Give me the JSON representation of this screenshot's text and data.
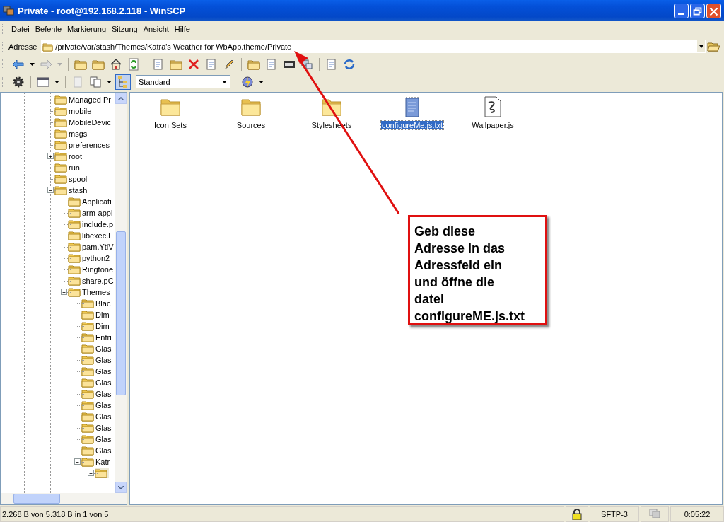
{
  "window": {
    "title": "Private - root@192.168.2.118 - WinSCP"
  },
  "menu": [
    "Datei",
    "Befehle",
    "Markierung",
    "Sitzung",
    "Ansicht",
    "Hilfe"
  ],
  "address": {
    "label": "Adresse",
    "value": "/private/var/stash/Themes/Katra's Weather for WbApp.theme/Private"
  },
  "toolbar": {
    "preset": "Standard"
  },
  "tree": [
    {
      "name": "Managed Pr",
      "selected": false
    },
    {
      "name": "mobile",
      "selected": false
    },
    {
      "name": "MobileDevic",
      "selected": false
    },
    {
      "name": "msgs",
      "selected": false
    },
    {
      "name": "preferences",
      "selected": false
    },
    {
      "name": "root",
      "selected": false,
      "expanded": false
    },
    {
      "name": "run",
      "selected": false
    },
    {
      "name": "spool",
      "selected": false
    },
    {
      "name": "stash",
      "selected": false,
      "expanded": true,
      "children": [
        {
          "name": "Applicati",
          "selected": false
        },
        {
          "name": "arm-appl",
          "selected": false
        },
        {
          "name": "include.p",
          "selected": false
        },
        {
          "name": "libexec.l",
          "selected": false
        },
        {
          "name": "pam.YtlV",
          "selected": false
        },
        {
          "name": "python2",
          "selected": false
        },
        {
          "name": "Ringtone",
          "selected": false
        },
        {
          "name": "share.pC",
          "selected": false
        },
        {
          "name": "Themes",
          "selected": false,
          "expanded": true,
          "children": [
            {
              "name": "Blac",
              "selected": false
            },
            {
              "name": "Dim",
              "selected": false
            },
            {
              "name": "Dim",
              "selected": false
            },
            {
              "name": "Entri",
              "selected": false
            },
            {
              "name": "Glas",
              "selected": false
            },
            {
              "name": "Glas",
              "selected": false
            },
            {
              "name": "Glas",
              "selected": false
            },
            {
              "name": "Glas",
              "selected": false
            },
            {
              "name": "Glas",
              "selected": false
            },
            {
              "name": "Glas",
              "selected": false
            },
            {
              "name": "Glas",
              "selected": false
            },
            {
              "name": "Glas",
              "selected": false
            },
            {
              "name": "Glas",
              "selected": false
            },
            {
              "name": "Glas",
              "selected": false
            },
            {
              "name": "Katr",
              "selected": false,
              "expanded": true,
              "children": [
                {
                  "selected": true,
                  "expanded": false
                }
              ]
            }
          ]
        }
      ]
    }
  ],
  "files": [
    {
      "name": "Icon Sets",
      "kind": "folder",
      "selected": false
    },
    {
      "name": "Sources",
      "kind": "folder",
      "selected": false
    },
    {
      "name": "Stylesheets",
      "kind": "folder",
      "selected": false
    },
    {
      "name": "configureMe.js.txt",
      "kind": "text",
      "selected": true
    },
    {
      "name": "Wallpaper.js",
      "kind": "script",
      "selected": false
    }
  ],
  "status_bar": {
    "selection": "2.268 B von 5.318 B in 1 von 5",
    "protocol": "SFTP-3",
    "time": "0:05:22"
  },
  "annotation": {
    "lines": [
      "Geb diese",
      "Adresse in das",
      "Adressfeld ein",
      "und öffne die",
      "datei",
      "configureME.js.txt"
    ]
  }
}
